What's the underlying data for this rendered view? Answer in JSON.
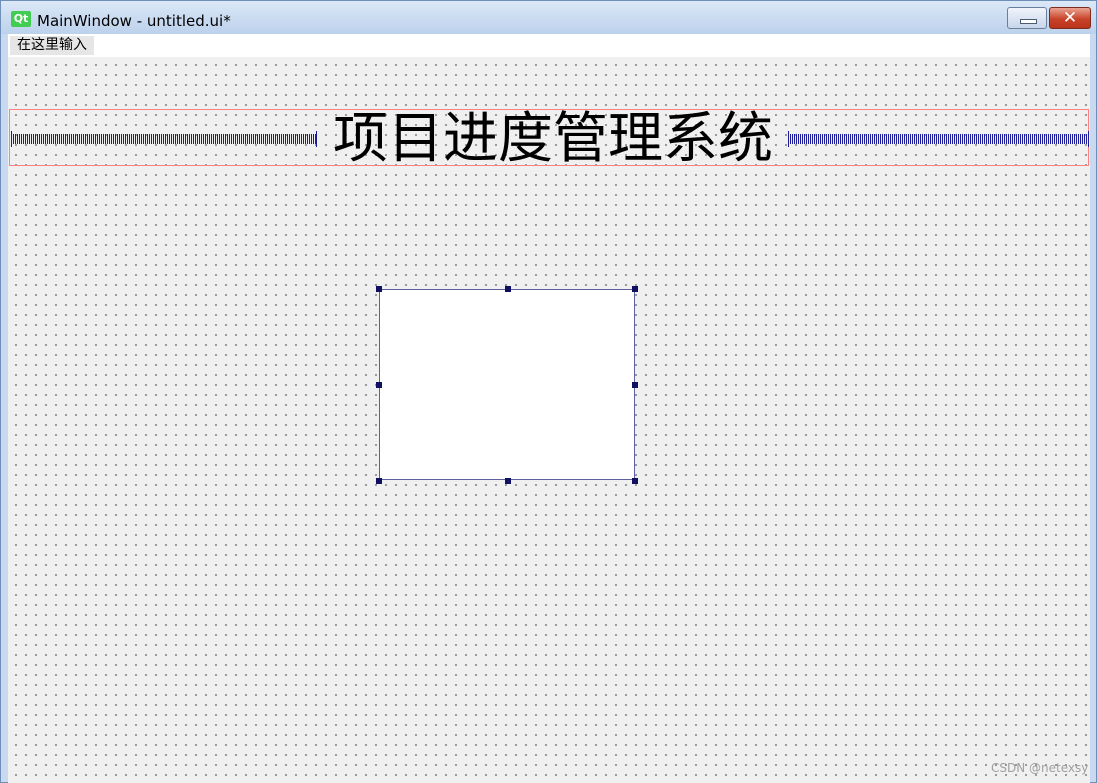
{
  "window": {
    "title": "MainWindow - untitled.ui*",
    "app_logo_text": "Qt",
    "minimize_icon": "minimize-icon",
    "close_icon": "close-icon"
  },
  "menubar": {
    "items": [
      {
        "label": "在这里输入"
      }
    ]
  },
  "form": {
    "heading": "项目进度管理系统"
  },
  "watermark": "CSDN @netexsy",
  "colors": {
    "layout_border": "#ff8080",
    "spacer": "#1d1d9a",
    "selection_handle": "#101060",
    "canvas": "#f0f0f0",
    "close_button": "#c9432a"
  }
}
